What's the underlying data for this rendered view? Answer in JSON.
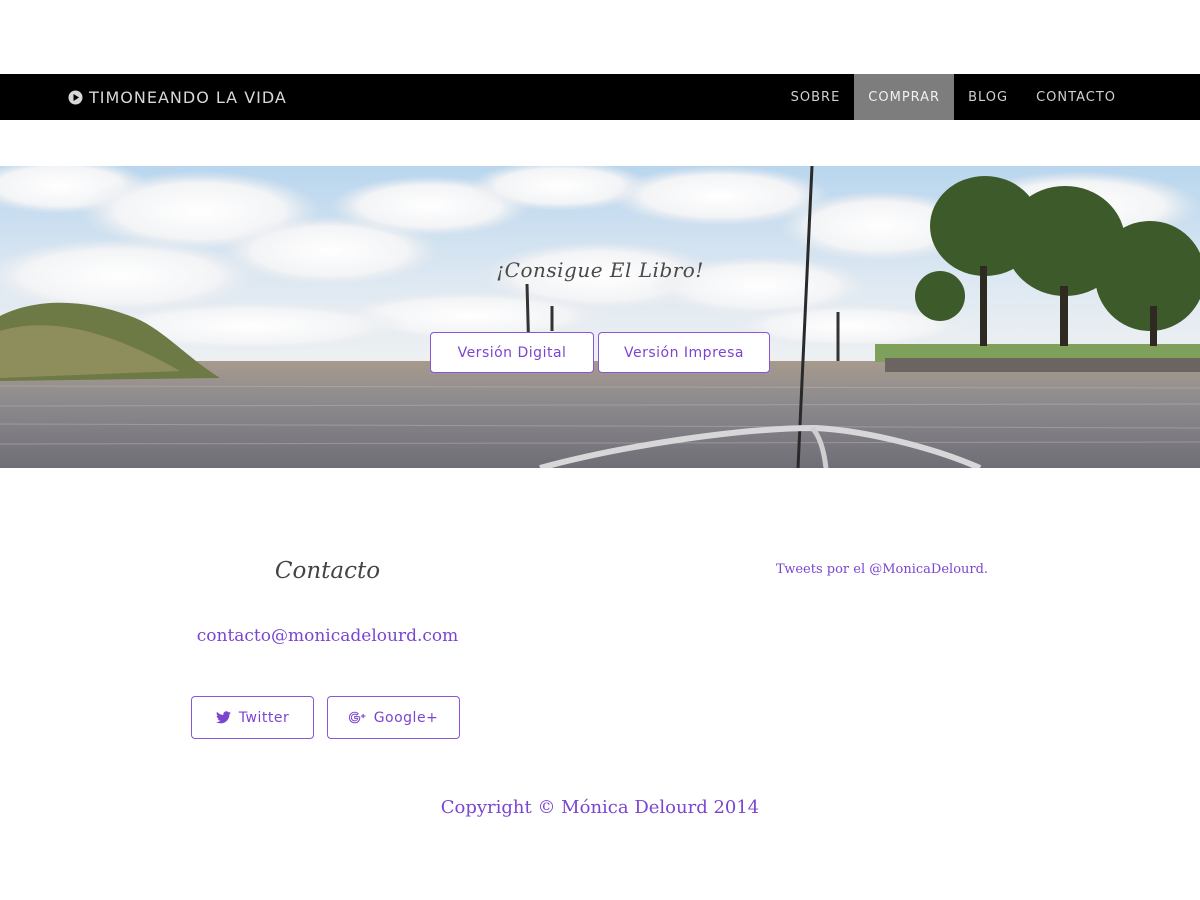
{
  "navbar": {
    "brand_label": "TIMONEANDO LA VIDA",
    "brand_icon": "play-circle-icon",
    "items": [
      {
        "label": "SOBRE",
        "active": false
      },
      {
        "label": "COMPRAR",
        "active": true
      },
      {
        "label": "BLOG",
        "active": false
      },
      {
        "label": "CONTACTO",
        "active": false
      }
    ]
  },
  "hero": {
    "title": "¡Consigue El Libro!",
    "buttons": [
      {
        "label": "Versión Digital"
      },
      {
        "label": "Versión Impresa"
      }
    ]
  },
  "contact": {
    "title": "Contacto",
    "email": "contacto@monicadelourd.com",
    "social": [
      {
        "label": "Twitter",
        "icon": "twitter-icon"
      },
      {
        "label": "Google+",
        "icon": "google-plus-icon"
      }
    ]
  },
  "tweets": {
    "link_label": "Tweets por el @MonicaDelourd."
  },
  "footer": {
    "copyright": "Copyright © Mónica Delourd 2014"
  },
  "colors": {
    "accent": "#7b45d0",
    "navbar_bg": "#000000",
    "nav_active_bg": "#7d7d7d"
  }
}
